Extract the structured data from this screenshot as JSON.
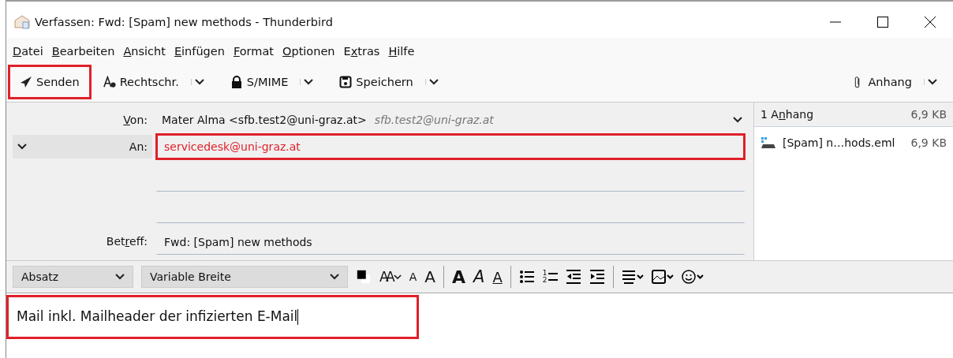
{
  "window": {
    "title": "Verfassen: Fwd: [Spam] new methods - Thunderbird"
  },
  "menu": [
    {
      "key": "D",
      "after": "atei"
    },
    {
      "key": "B",
      "after": "earbeiten"
    },
    {
      "key": "A",
      "after": "nsicht"
    },
    {
      "key": "E",
      "after": "infügen"
    },
    {
      "key": "F",
      "after": "ormat"
    },
    {
      "key": "O",
      "after": "ptionen"
    },
    {
      "before": "E",
      "key": "x",
      "after": "tras"
    },
    {
      "key": "H",
      "after": "ilfe"
    }
  ],
  "toolbar": [
    {
      "kind": "send",
      "label": "Senden",
      "highlighted": true,
      "dropdown": false
    },
    {
      "kind": "spell",
      "label": "Rechtschr.",
      "highlighted": false,
      "dropdown": true
    },
    {
      "kind": "lock",
      "label": "S/MIME",
      "highlighted": false,
      "dropdown": true
    },
    {
      "kind": "save",
      "label": "Speichern",
      "highlighted": false,
      "dropdown": true
    }
  ],
  "attach_button": {
    "label": "Anhang"
  },
  "from": {
    "label_key": "V",
    "label_after": "on:",
    "value": "Mater Alma <sfb.test2@uni-graz.at>",
    "hint": "sfb.test2@uni-graz.at"
  },
  "recipients": [
    {
      "label": "An:",
      "value": "servicedesk@uni-graz.at",
      "highlighted": true
    },
    {
      "highlighted": false
    },
    {
      "highlighted": false
    }
  ],
  "subject": {
    "label_before": "Bet",
    "label_key": "r",
    "label_after": "eff:",
    "value": "Fwd: [Spam] new methods"
  },
  "attachments": {
    "header_before": "1 A",
    "header_key": "n",
    "header_after": "hang",
    "total": "6,9 KB",
    "items": [
      {
        "name": "[Spam] n…hods.eml",
        "size": "6,9 KB"
      }
    ]
  },
  "format": {
    "paragraph": "Absatz",
    "font": "Variable Breite",
    "buttons": [
      {
        "kind": "color"
      },
      {
        "kind": "size",
        "label": "AA"
      },
      {
        "kind": "smaller",
        "label": "A"
      },
      {
        "kind": "larger",
        "label": "A"
      },
      {
        "kind": "sep"
      },
      {
        "kind": "bold",
        "label": "A"
      },
      {
        "kind": "italic",
        "label": "A"
      },
      {
        "kind": "underline",
        "label": "A"
      },
      {
        "kind": "sep"
      },
      {
        "kind": "bullets"
      },
      {
        "kind": "numbers",
        "label": "1\n2"
      },
      {
        "kind": "outdent"
      },
      {
        "kind": "indent"
      },
      {
        "kind": "sep"
      },
      {
        "kind": "align"
      },
      {
        "kind": "image"
      },
      {
        "kind": "emoji"
      }
    ]
  },
  "body": {
    "text": "Mail inkl. Mailheader der infizierten E-Mail",
    "highlighted": true
  }
}
